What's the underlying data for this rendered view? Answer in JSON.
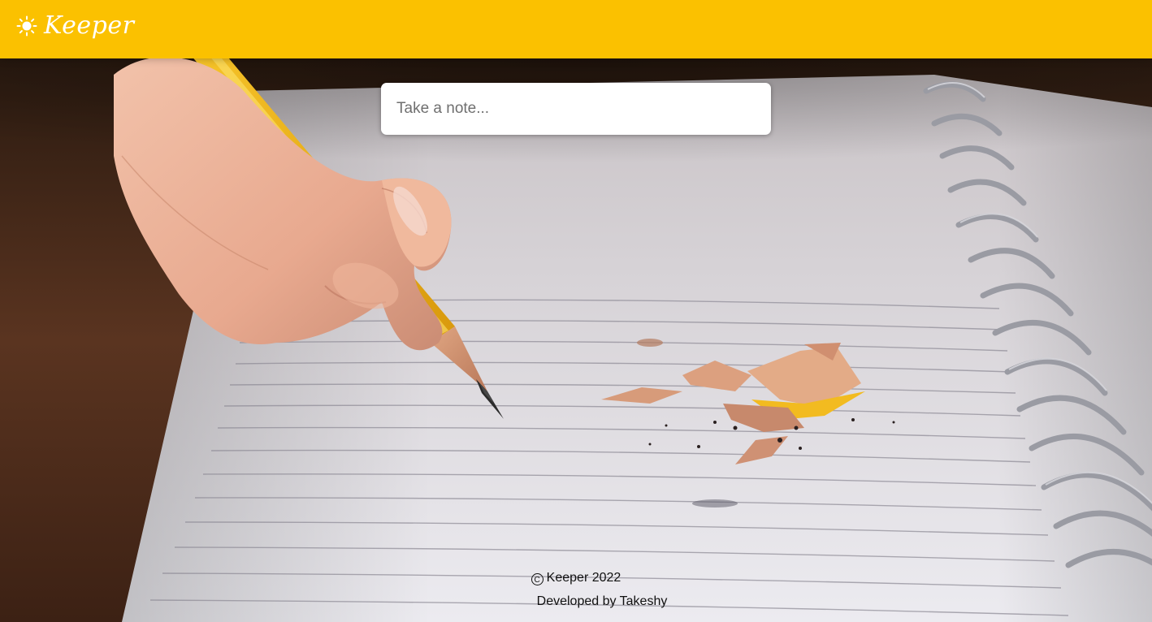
{
  "header": {
    "logo_icon": "sun-icon",
    "title": "Keeper",
    "background_color": "#fbc100"
  },
  "note": {
    "placeholder": "Take a note..."
  },
  "footer": {
    "copyright_icon": "copyright-icon",
    "copyright_text": "Keeper 2022",
    "developer_text": "Developed by Takeshy"
  },
  "background_image": "pencil-writing-on-notebook"
}
